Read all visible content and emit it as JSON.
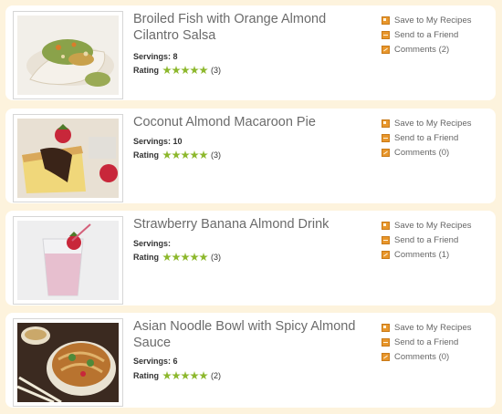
{
  "recipes": [
    {
      "title": "Broiled Fish with Orange Almond Cilantro Salsa",
      "servings_label": "Servings: 8",
      "rating_label": "Rating",
      "rating_stars": 5,
      "rating_count": "(3)",
      "save_label": "Save to My Recipes",
      "send_label": "Send to a Friend",
      "comments_label": "Comments (2)",
      "image_alt": "Broiled fish topped with almond cilantro salsa"
    },
    {
      "title": "Coconut Almond Macaroon Pie",
      "servings_label": "Servings: 10",
      "rating_label": "Rating",
      "rating_stars": 5,
      "rating_count": "(3)",
      "save_label": "Save to My Recipes",
      "send_label": "Send to a Friend",
      "comments_label": "Comments (0)",
      "image_alt": "Slice of coconut almond pie with chocolate drizzle and strawberries"
    },
    {
      "title": "Strawberry Banana Almond Drink",
      "servings_label": "Servings:",
      "rating_label": "Rating",
      "rating_stars": 5,
      "rating_count": "(3)",
      "save_label": "Save to My Recipes",
      "send_label": "Send to a Friend",
      "comments_label": "Comments (1)",
      "image_alt": "Pink strawberry smoothie with strawberry garnish"
    },
    {
      "title": "Asian Noodle Bowl with Spicy Almond Sauce",
      "servings_label": "Servings: 6",
      "rating_label": "Rating",
      "rating_stars": 5,
      "rating_count": "(2)",
      "save_label": "Save to My Recipes",
      "send_label": "Send to a Friend",
      "comments_label": "Comments (0)",
      "image_alt": "Bowl of noodles with vegetables and chopsticks"
    }
  ],
  "colors": {
    "page_background": "#fdf3dd",
    "star_green": "#8db82d",
    "icon_orange": "#e8962b"
  }
}
